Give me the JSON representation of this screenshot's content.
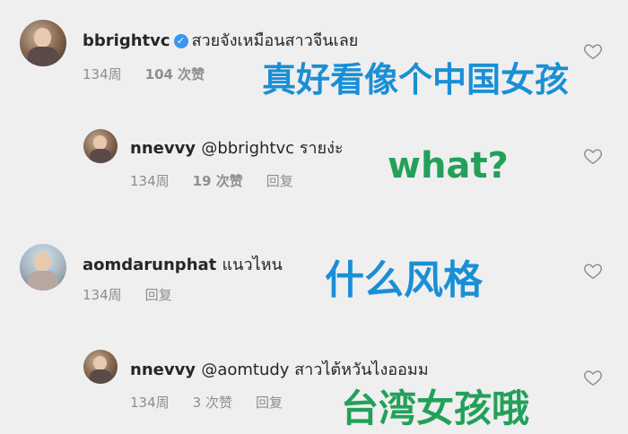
{
  "comments": [
    {
      "username": "bbrightvc",
      "verified": true,
      "text": "สวยจังเหมือนสาวจีนเลย",
      "time": "134周",
      "likes": "104 次赞",
      "reply": "回复",
      "translation": "真好看像个中国女孩"
    },
    {
      "username": "nnevvy",
      "text": "@bbrightvc รายง่ะ",
      "time": "134周",
      "likes": "19 次赞",
      "reply": "回复",
      "translation": "what?"
    },
    {
      "username": "aomdarunphat",
      "text": "แนวไหน",
      "time": "134周",
      "reply": "回复",
      "translation": "什么风格"
    },
    {
      "username": "nnevvy",
      "text": "@aomtudy สาวไต้หวันไงออมม",
      "time": "134周",
      "likes": "3 次赞",
      "reply": "回复",
      "translation": "台湾女孩哦"
    }
  ],
  "icons": {
    "heart": "heart-icon",
    "verified": "verified-badge-icon"
  },
  "colors": {
    "overlay_blue": "#1a8fd6",
    "overlay_green": "#23a05a",
    "meta_gray": "#8e8e8e"
  }
}
